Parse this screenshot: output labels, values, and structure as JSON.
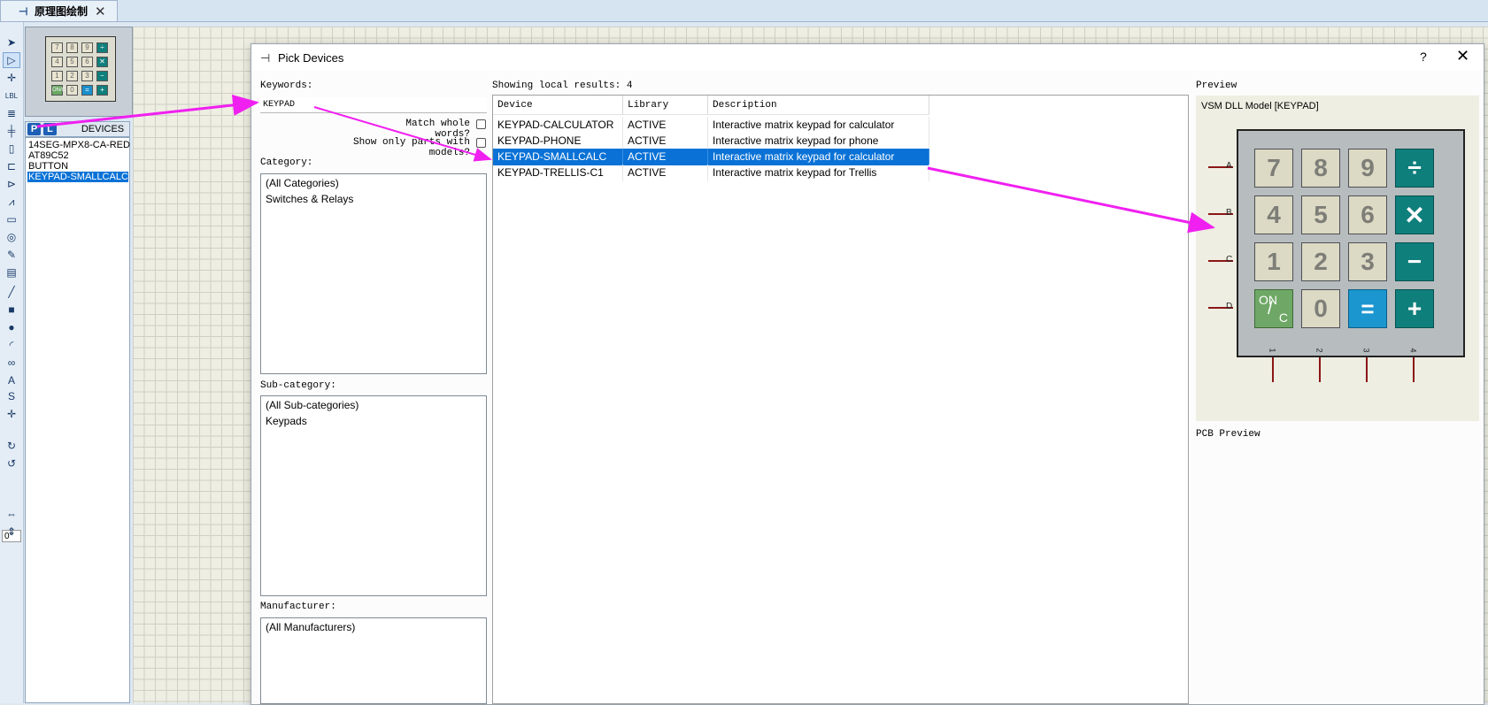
{
  "tab": {
    "label": "原理图绘制",
    "close": "✕"
  },
  "toolbar": {
    "tools": [
      {
        "name": "selection-mode-icon",
        "glyph": "➤"
      },
      {
        "name": "component-mode-icon",
        "glyph": "▷",
        "active": true
      },
      {
        "name": "junction-dot-icon",
        "glyph": "✛"
      },
      {
        "name": "wire-label-icon",
        "glyph": "LBL"
      },
      {
        "name": "text-script-icon",
        "glyph": "≣"
      },
      {
        "name": "buses-icon",
        "glyph": "╪"
      },
      {
        "name": "sub-circuit-icon",
        "glyph": "▯"
      },
      {
        "name": "terminals-icon",
        "glyph": "⊏"
      },
      {
        "name": "device-pins-icon",
        "glyph": "⊳"
      },
      {
        "name": "graph-icon",
        "glyph": "⩘"
      },
      {
        "name": "tape-recorder-icon",
        "glyph": "▭"
      },
      {
        "name": "generator-icon",
        "glyph": "◎"
      },
      {
        "name": "voltage-probe-icon",
        "glyph": "✎"
      },
      {
        "name": "virtual-instruments-icon",
        "glyph": "▤"
      },
      {
        "name": "line-icon",
        "glyph": "╱"
      },
      {
        "name": "box-icon",
        "glyph": "■"
      },
      {
        "name": "circle-icon",
        "glyph": "●"
      },
      {
        "name": "arc-icon",
        "glyph": "◜"
      },
      {
        "name": "path-icon",
        "glyph": "∞"
      },
      {
        "name": "text-icon",
        "glyph": "A"
      },
      {
        "name": "symbol-icon",
        "glyph": "S"
      },
      {
        "name": "marker-icon",
        "glyph": "✛"
      },
      {
        "name": "rotate-clockwise-icon",
        "glyph": "↻"
      },
      {
        "name": "rotate-anticlockwise-icon",
        "glyph": "↺"
      }
    ],
    "angle": "0°",
    "flip_tools": [
      {
        "name": "flip-horizontal-icon",
        "glyph": "⇔"
      },
      {
        "name": "flip-vertical-icon",
        "glyph": "⇕"
      }
    ]
  },
  "devices_panel": {
    "p_button": "P",
    "l_button": "L",
    "title": "DEVICES",
    "items": [
      "14SEG-MPX8-CA-RED",
      "AT89C52",
      "BUTTON",
      "KEYPAD-SMALLCALC"
    ],
    "selected_index": 3
  },
  "dialog": {
    "title": "Pick Devices",
    "help": "?",
    "close": "✕",
    "keywords_label": "Keywords:",
    "keywords_value": "KEYPAD",
    "match_whole_words": "Match whole words?",
    "show_only_parts": "Show only parts with models?",
    "category_label": "Category:",
    "categories": [
      "(All Categories)",
      "Switches & Relays"
    ],
    "subcategory_label": "Sub-category:",
    "subcategories": [
      "(All Sub-categories)",
      "Keypads"
    ],
    "manufacturer_label": "Manufacturer:",
    "manufacturers": [
      "(All Manufacturers)"
    ],
    "results_label": "Showing local results: 4",
    "columns": [
      "Device",
      "Library",
      "Description"
    ],
    "rows": [
      {
        "device": "KEYPAD-CALCULATOR",
        "library": "ACTIVE",
        "description": "Interactive matrix keypad for calculator"
      },
      {
        "device": "KEYPAD-PHONE",
        "library": "ACTIVE",
        "description": "Interactive matrix keypad for phone"
      },
      {
        "device": "KEYPAD-SMALLCALC",
        "library": "ACTIVE",
        "description": "Interactive matrix keypad for calculator"
      },
      {
        "device": "KEYPAD-TRELLIS-C1",
        "library": "ACTIVE",
        "description": "Interactive matrix keypad for Trellis"
      }
    ],
    "selected_row": 2,
    "preview_label": "Preview",
    "preview_model": "VSM DLL Model [KEYPAD]",
    "pcb_preview_label": "PCB Preview"
  },
  "keypad": {
    "row_labels": [
      "A",
      "B",
      "C",
      "D"
    ],
    "col_labels": [
      "1",
      "2",
      "3",
      "4"
    ],
    "keys": [
      [
        "7",
        "8",
        "9",
        "÷"
      ],
      [
        "4",
        "5",
        "6",
        "✕"
      ],
      [
        "1",
        "2",
        "3",
        "−"
      ],
      [
        "ON/C",
        "0",
        "=",
        "+"
      ]
    ],
    "on_top": "ON",
    "on_bottom": "C"
  },
  "colors": {
    "annotation_arrow": "#f020f0",
    "selection": "#0a72d6",
    "key_operator": "#0f7f7c",
    "key_equals": "#1b96cf",
    "key_on": "#6fa866"
  }
}
